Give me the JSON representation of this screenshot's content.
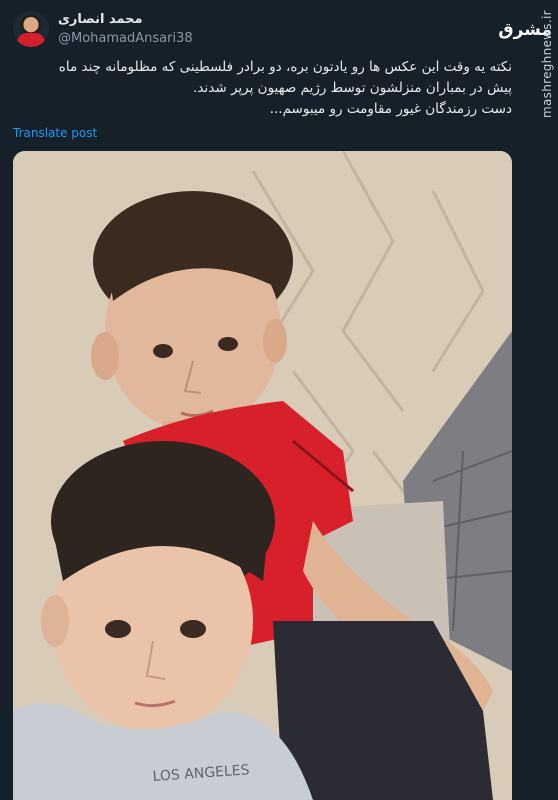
{
  "tweet": {
    "display_name": "محمد انصاری",
    "handle": "@MohamadAnsari38",
    "text_lines": [
      "نکته یه وقت این عکس ها رو یادتون بره، دو برادر فلسطینی که مظلومانه چند ماه",
      "پیش در بمباران منزلشون توسط رژیم صهیون پرپر شدند.",
      "دست رزمندگان غیور مقاومت رو میبوسم..."
    ],
    "translate_label": "Translate post"
  },
  "branding": {
    "logo_text": "مشرق",
    "watermark": "mashreghnews.ir"
  },
  "photo": {
    "shirt_print": "LOS ANGELES"
  }
}
